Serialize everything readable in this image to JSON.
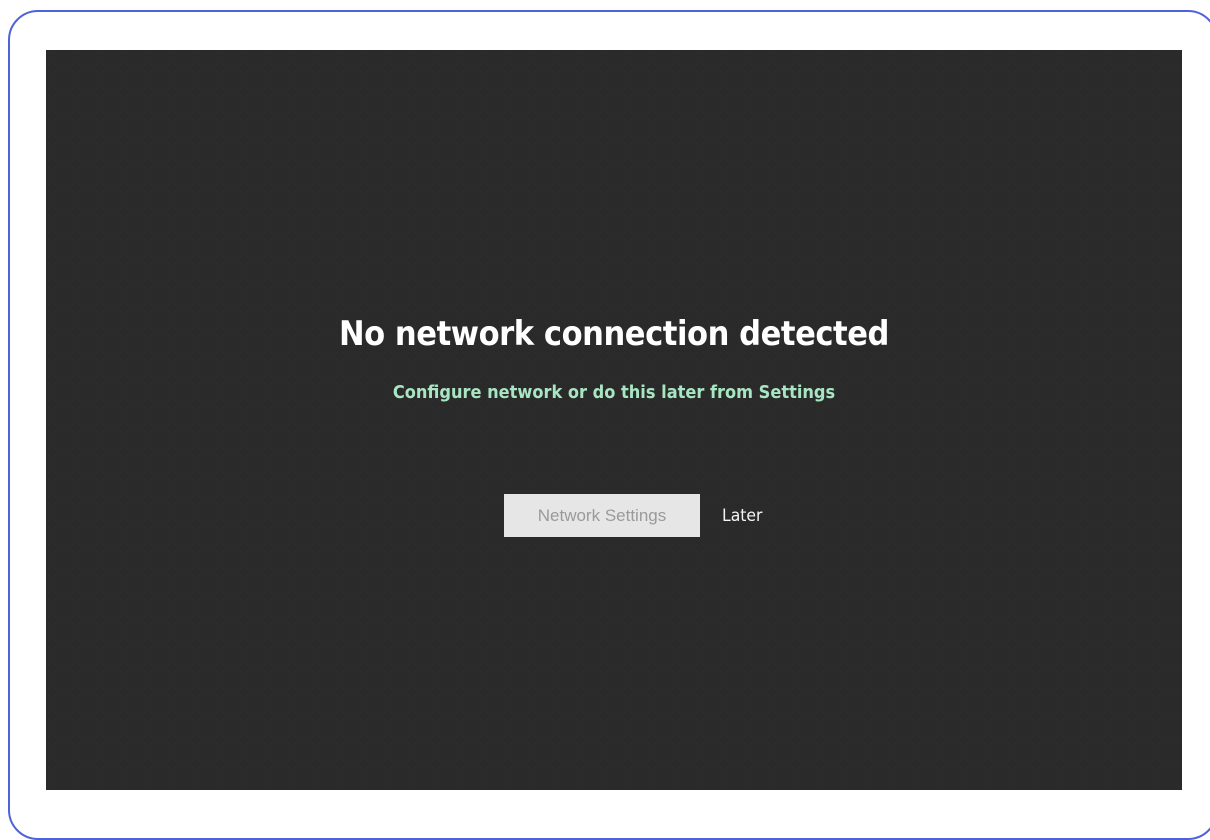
{
  "dialog": {
    "title": "No network connection detected",
    "subtitle": "Configure network or do this later from Settings",
    "primary_button": "Network Settings",
    "secondary_button": "Later"
  },
  "colors": {
    "frame_border": "#4f63d9",
    "screen_background": "#2a2a2a",
    "title_text": "#ffffff",
    "subtitle_text": "#a8e6c3",
    "primary_button_bg": "#e6e6e6",
    "primary_button_text": "#9a9a9a",
    "secondary_button_text": "#f5f5f5"
  }
}
